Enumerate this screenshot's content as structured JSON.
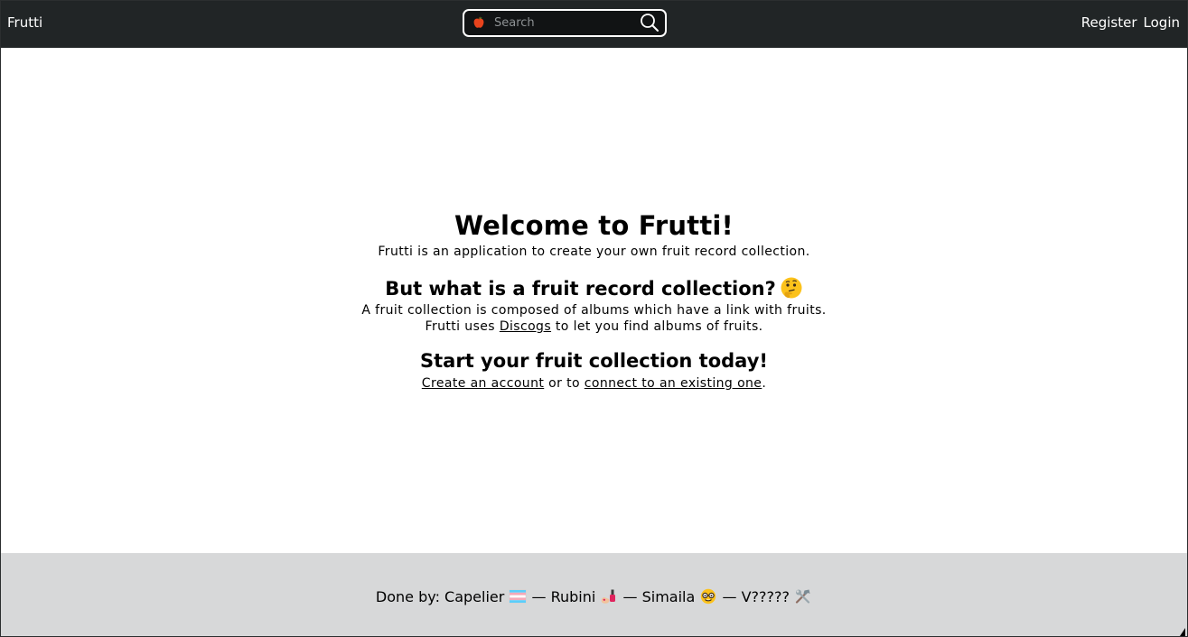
{
  "navbar": {
    "brand": "Frutti",
    "search": {
      "placeholder": "Search",
      "value": "",
      "fruit_icon": "apple-icon",
      "button_icon": "search-icon"
    },
    "links": {
      "register": "Register",
      "login": "Login"
    },
    "colors": {
      "background": "#212526",
      "text": "#ffffff"
    }
  },
  "main": {
    "welcome_title": "Welcome to Frutti!",
    "intro": "Frutti is an application to create your own fruit record collection.",
    "question_title": "But what is a fruit record collection?",
    "question_icon": "thinking-face-icon",
    "description_line1": "A fruit collection is composed of albums which have a link with fruits.",
    "description_line2_prefix": "Frutti uses ",
    "description_line2_link": "Discogs",
    "description_line2_suffix": " to let you find albums of fruits.",
    "cta_title": "Start your fruit collection today!",
    "cta_create_link": "Create an account",
    "cta_middle": " or to ",
    "cta_connect_link": "connect to an existing one",
    "cta_end": "."
  },
  "footer": {
    "prefix": "Done by: ",
    "separator": " — ",
    "authors": [
      {
        "name": "Capelier",
        "icon": "transgender-flag-icon"
      },
      {
        "name": "Rubini",
        "icon": "nail-polish-icon"
      },
      {
        "name": "Simaila",
        "icon": "nerd-face-icon"
      },
      {
        "name": "V?????",
        "icon": "hammer-and-wrench-icon"
      }
    ],
    "background": "#d7d8d9"
  }
}
